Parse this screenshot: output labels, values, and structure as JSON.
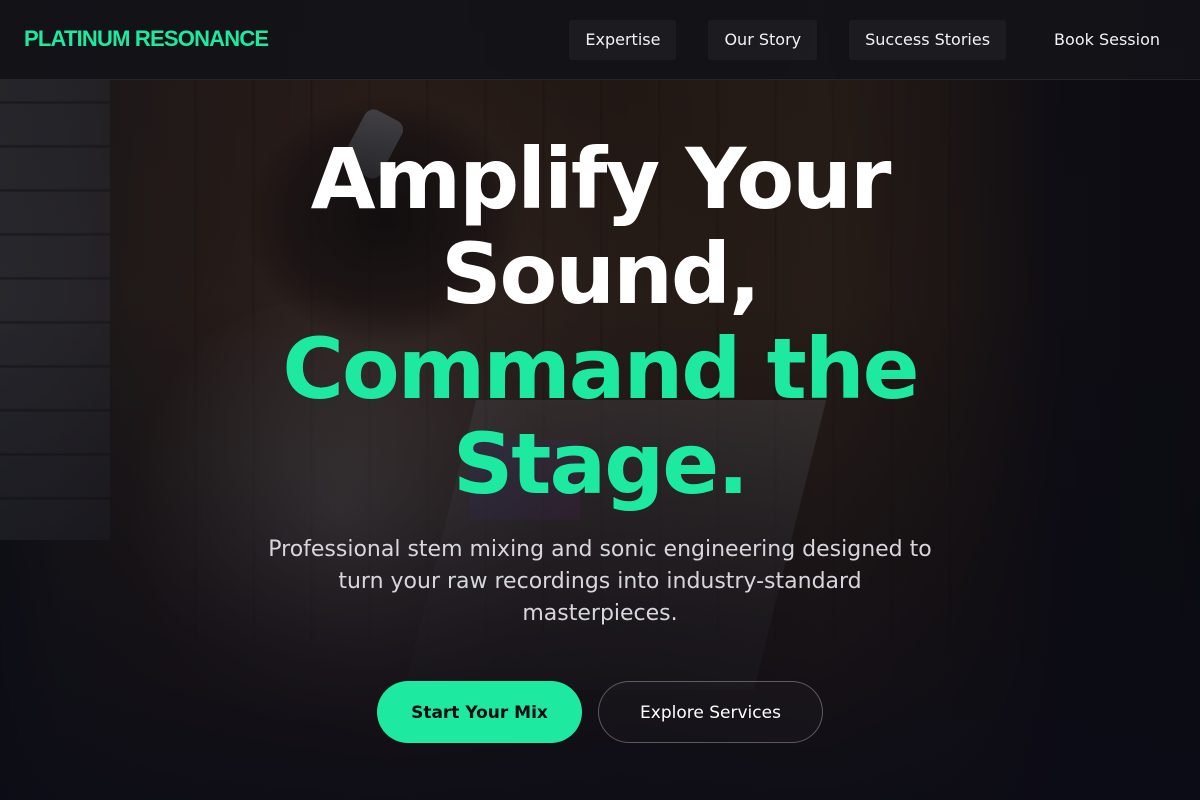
{
  "header": {
    "logo_text": "PLATINUM RESONANCE",
    "nav": [
      {
        "label": "Expertise"
      },
      {
        "label": "Our Story"
      },
      {
        "label": "Success Stories"
      },
      {
        "label": "Book Session"
      }
    ]
  },
  "hero": {
    "headline_line1": "Amplify Your",
    "headline_line2": "Sound,",
    "headline_accent_line1": "Command the",
    "headline_accent_line2": "Stage.",
    "subtitle": "Professional stem mixing and sonic engineering designed to turn your raw recordings into industry-standard masterpieces.",
    "primary_cta": "Start Your Mix",
    "secondary_cta": "Explore Services"
  },
  "colors": {
    "accent": "#1de9a0",
    "background": "#0d0d14",
    "text": "#ffffff"
  }
}
